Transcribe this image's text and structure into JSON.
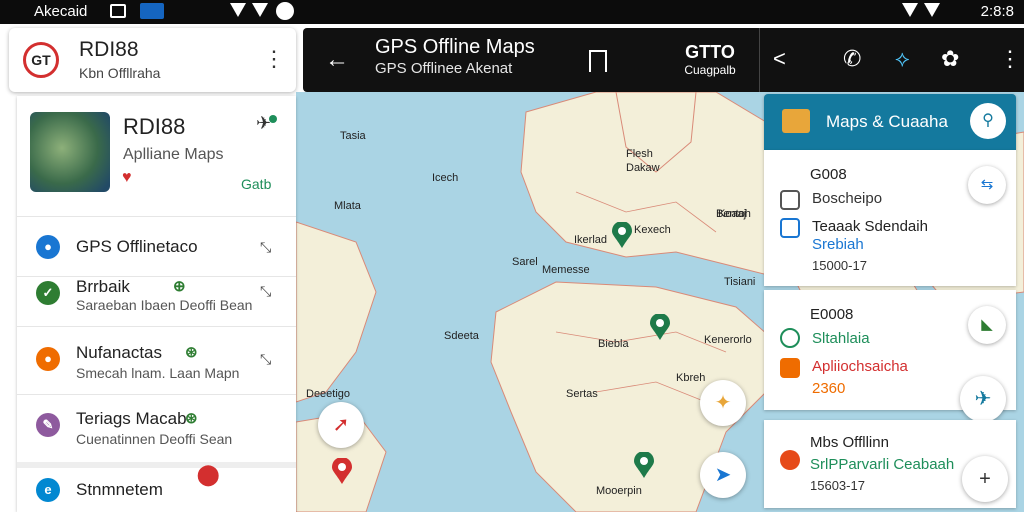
{
  "status_bar": {
    "left_text": "Akecaid",
    "right_text": "2:8:8"
  },
  "map_toolbar": {
    "title": "GPS Offline Maps",
    "subtitle": "GPS Offlinee Akenat",
    "center_top": "GTTO",
    "center_bottom": "Cuagpalb"
  },
  "app_card": {
    "logo_text": "GT",
    "name": "RDI88",
    "subtitle": "Kbn Offllraha"
  },
  "detail": {
    "name": "RDI88",
    "subtitle": "Aplliane Maps",
    "action": "Gatb"
  },
  "list_items": [
    {
      "label": "GPS Offlinetaco",
      "sub": "",
      "icon_color": "#1976d2",
      "icon_text": "●"
    },
    {
      "label": "Brrbaik",
      "sub": "Saraeban Ibaen Deoffi Bean",
      "icon_color": "#2e7d32",
      "icon_text": "✓"
    },
    {
      "label": "Nufanactas",
      "sub": "Smecah lnam. Laan Mapn",
      "icon_color": "#ef6c00",
      "icon_text": "●"
    },
    {
      "label": "Teriags Macab",
      "sub": "Cuenatinnen Deoffi Sean",
      "icon_color": "#8e5a9e",
      "icon_text": "✎"
    },
    {
      "label": "Stnmnetem",
      "sub": "",
      "icon_color": "#0288d1",
      "icon_text": "e"
    }
  ],
  "right_panel": {
    "title": "Maps & Cuaaha",
    "card1": {
      "head": "G008",
      "line1": "Boscheipo",
      "line2": "Teaaak Sdendaih",
      "line3": "Srebiah",
      "date": "15000-17"
    },
    "card2": {
      "head": "E0008",
      "line1": "Sltahlaia",
      "line2": "Apliiochsaicha",
      "line3": "2360"
    },
    "card3": {
      "head": "Mbs Offllinn",
      "line1": "SrlPParvarli Ceabaah",
      "date": "15603-17"
    }
  },
  "map_labels": [
    "Tasia",
    "Icech",
    "Mlata",
    "Flesh",
    "Dakaw",
    "Kexech",
    "Ikerlad",
    "Sarel",
    "Memesse",
    "Koaaj",
    "Tisiani",
    "Sdeeta",
    "Biebla",
    "Kenerorlo",
    "Kbreh",
    "Sertas",
    "Deeetigo",
    "Mooerpin",
    "Bentoh"
  ],
  "colors": {
    "toolbar_bg": "#111111",
    "panel_header": "#14799e",
    "sea": "#aad4e4",
    "land": "#f3efd9",
    "accent_green": "#1e8e5a",
    "accent_red": "#d32f2f"
  }
}
